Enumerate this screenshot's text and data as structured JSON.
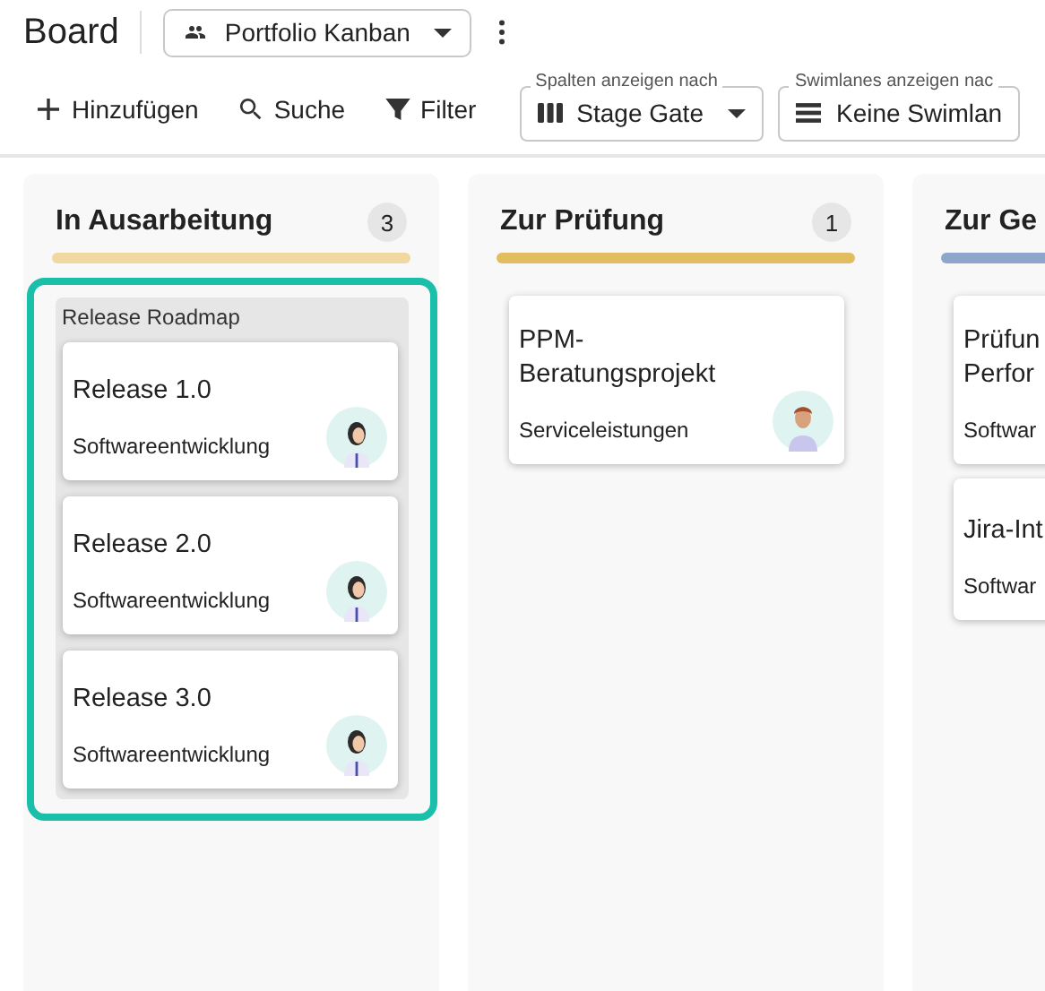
{
  "header": {
    "title": "Board",
    "board_select": {
      "value": "Portfolio Kanban"
    }
  },
  "toolbar": {
    "actions": [
      {
        "label": "Hinzufügen",
        "kind": "add"
      },
      {
        "label": "Suche",
        "kind": "search"
      },
      {
        "label": "Filter",
        "kind": "filter"
      }
    ],
    "selects": [
      {
        "legend": "Spalten anzeigen nach",
        "value": "Stage Gate",
        "kind": "columns"
      },
      {
        "legend": "Swimlanes anzeigen nac",
        "value": "Keine Swimlan",
        "kind": "rows"
      }
    ]
  },
  "columns": [
    {
      "title": "In Ausarbeitung",
      "count": "3",
      "color": "#efd9a0",
      "swimlane": {
        "title": "Release Roadmap",
        "highlighted": true,
        "cards": [
          {
            "title": "Release 1.0",
            "subtitle": "Softwareentwicklung"
          },
          {
            "title": "Release 2.0",
            "subtitle": "Softwareentwicklung"
          },
          {
            "title": "Release 3.0",
            "subtitle": "Softwareentwicklung"
          }
        ]
      }
    },
    {
      "title": "Zur Prüfung",
      "count": "1",
      "color": "#e2bd5f",
      "cards": [
        {
          "title": "PPM-Beratungsprojekt",
          "subtitle": "Serviceleistungen"
        }
      ]
    },
    {
      "title": "Zur Ge",
      "color": "#8ea6cc",
      "cards": [
        {
          "title": "Prüfun\nPerfor",
          "subtitle": "Softwar"
        },
        {
          "title": "Jira-Int",
          "subtitle": "Softwar"
        }
      ]
    }
  ]
}
